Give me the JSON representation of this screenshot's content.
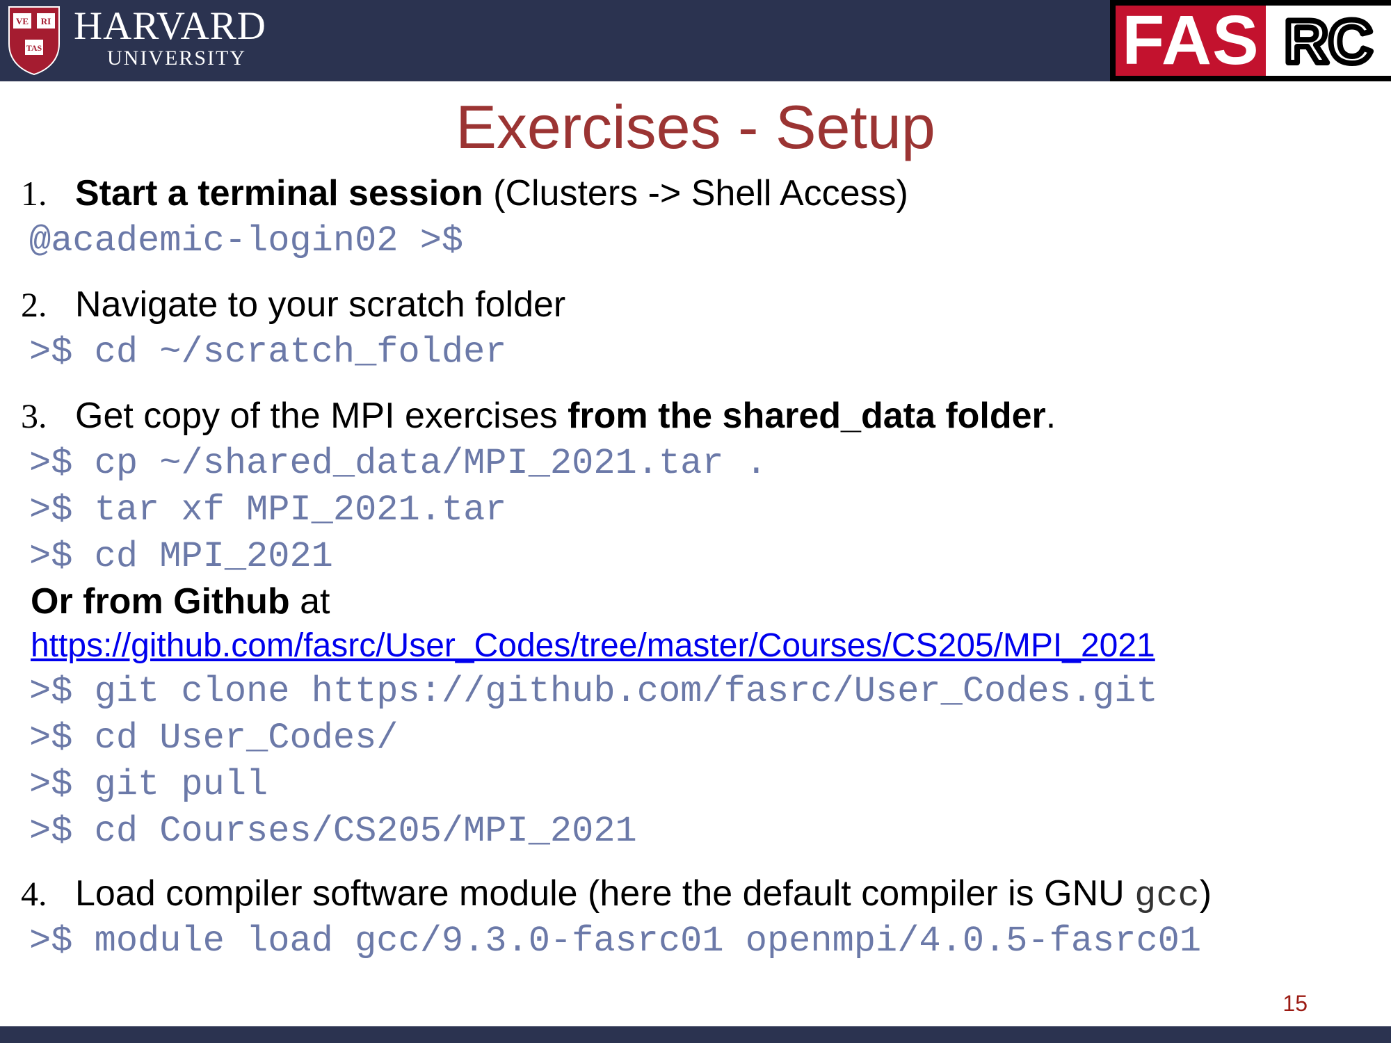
{
  "header": {
    "university_name": "HARVARD",
    "university_sub": "UNIVERSITY",
    "shield_letters": [
      "VE",
      "RI",
      "TAS"
    ],
    "fas_text": "FAS",
    "rc_text": "RC",
    "colors": {
      "bar": "#2b3350",
      "fas_red": "#c3122e",
      "title_red": "#9b3433"
    }
  },
  "title": "Exercises - Setup",
  "steps": [
    {
      "number": "1.",
      "bold": "Start a terminal session",
      "rest": " (Clusters -> Shell Access)",
      "commands": [
        "@academic-login02 >$"
      ]
    },
    {
      "number": "2.",
      "text": "Navigate to your scratch folder",
      "commands": [
        ">$ cd  ~/scratch_folder"
      ]
    },
    {
      "number": "3.",
      "text_before": "Get copy of the MPI exercises ",
      "bold": "from the shared_data folder",
      "text_after": ".",
      "commands": [
        ">$ cp ~/shared_data/MPI_2021.tar .",
        ">$ tar xf MPI_2021.tar",
        ">$ cd MPI_2021"
      ],
      "github_bold": "Or from Github",
      "github_rest": " at",
      "github_url": "https://github.com/fasrc/User_Codes/tree/master/Courses/CS205/MPI_2021",
      "github_commands": [
        ">$ git clone https://github.com/fasrc/User_Codes.git",
        ">$ cd User_Codes/",
        ">$ git pull",
        ">$ cd Courses/CS205/MPI_2021"
      ]
    },
    {
      "number": "4.",
      "text_before": "Load compiler software module (here the default compiler is GNU ",
      "mono": "gcc",
      "text_after": ")",
      "commands": [
        ">$ module load gcc/9.3.0-fasrc01 openmpi/4.0.5-fasrc01"
      ]
    }
  ],
  "page_number": "15"
}
